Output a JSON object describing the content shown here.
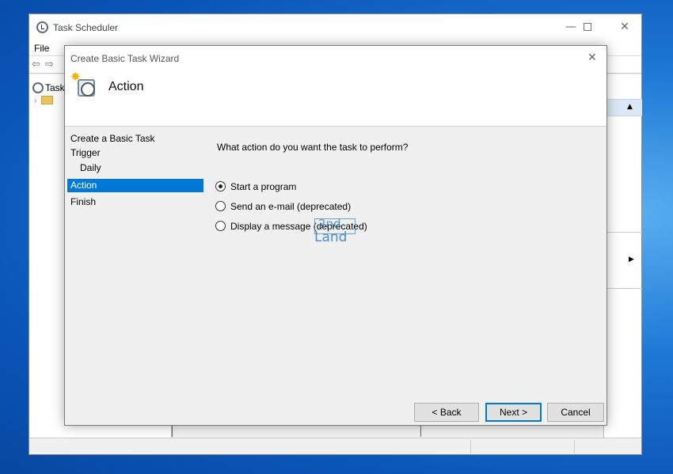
{
  "app": {
    "title": "Task Scheduler",
    "menu": [
      "File"
    ],
    "tree_root_label": "Task",
    "caption_min": "—",
    "caption_close": "✕"
  },
  "wizard": {
    "title": "Create Basic Task Wizard",
    "close_glyph": "✕",
    "header_title": "Action",
    "steps": [
      {
        "label": "Create a Basic Task",
        "active": false
      },
      {
        "label": "Trigger",
        "active": false
      },
      {
        "label": "Daily",
        "active": false,
        "sub": true
      },
      {
        "label": "Action",
        "active": true
      },
      {
        "label": "Finish",
        "active": false
      }
    ],
    "question": "What action do you want the task to perform?",
    "options": [
      {
        "label": "Start a program",
        "selected": true
      },
      {
        "label": "Send an e-mail (deprecated)",
        "selected": false
      },
      {
        "label": "Display a message (deprecated)",
        "selected": false
      }
    ],
    "buttons": {
      "back": "< Back",
      "next": "Next >",
      "cancel": "Cancel"
    }
  },
  "watermark": {
    "line1": "2nd",
    "line2": "Land"
  },
  "colors": {
    "accent": "#0078d7",
    "desktop": "#0a55b8"
  },
  "icons": {
    "app": "clock-icon",
    "wizard_header": "task-clock-star-icon",
    "nav_back": "arrow-left-icon",
    "nav_forward": "arrow-right-icon"
  }
}
